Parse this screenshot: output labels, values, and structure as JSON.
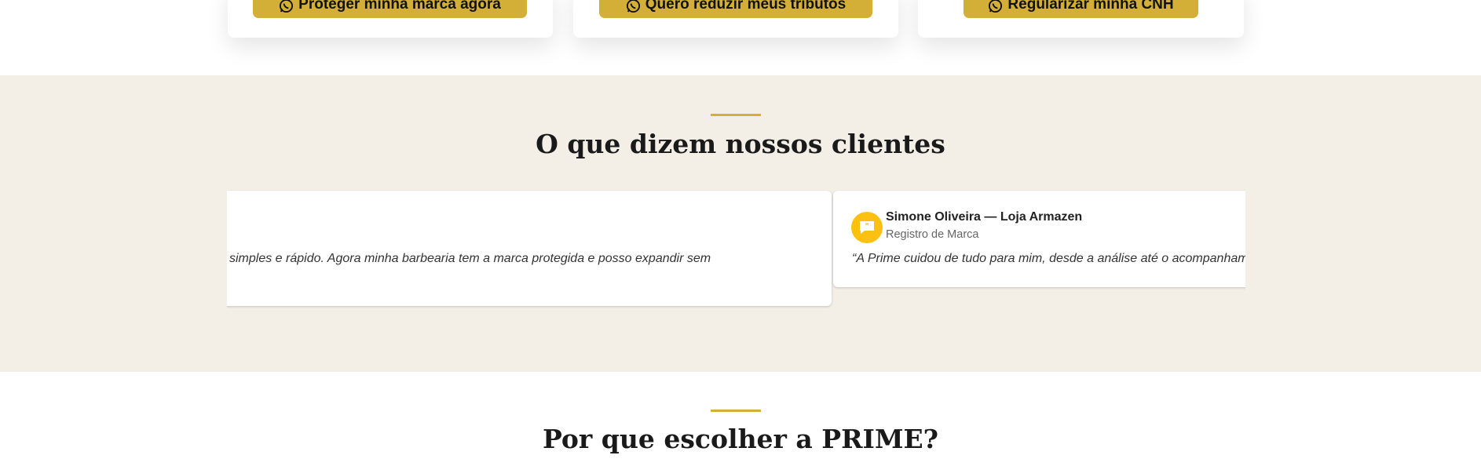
{
  "service_cards": [
    {
      "cta_label": "Proteger minha marca agora",
      "icon": "whatsapp-icon"
    },
    {
      "cta_label": "Quero reduzir meus tributos",
      "icon": "whatsapp-icon"
    },
    {
      "cta_label": "Regularizar minha CNH",
      "icon": "whatsapp-icon"
    }
  ],
  "testimonials": {
    "title": "O que dizem nossos clientes",
    "accent": "#d4af37",
    "items": [
      {
        "quote": "simples e rápido. Agora minha barbearia tem a marca protegida e posso expandir sem"
      },
      {
        "name": "Simone Oliveira — Loja Armazen",
        "service": "Registro de Marca",
        "quote": "“A Prime cuidou de tudo para mim, desde a análise até o acompanhamento",
        "icon": "quote-bubble-icon",
        "icon_color": "#fcc010"
      }
    ]
  },
  "why": {
    "title": "Por que escolher a PRIME?"
  }
}
